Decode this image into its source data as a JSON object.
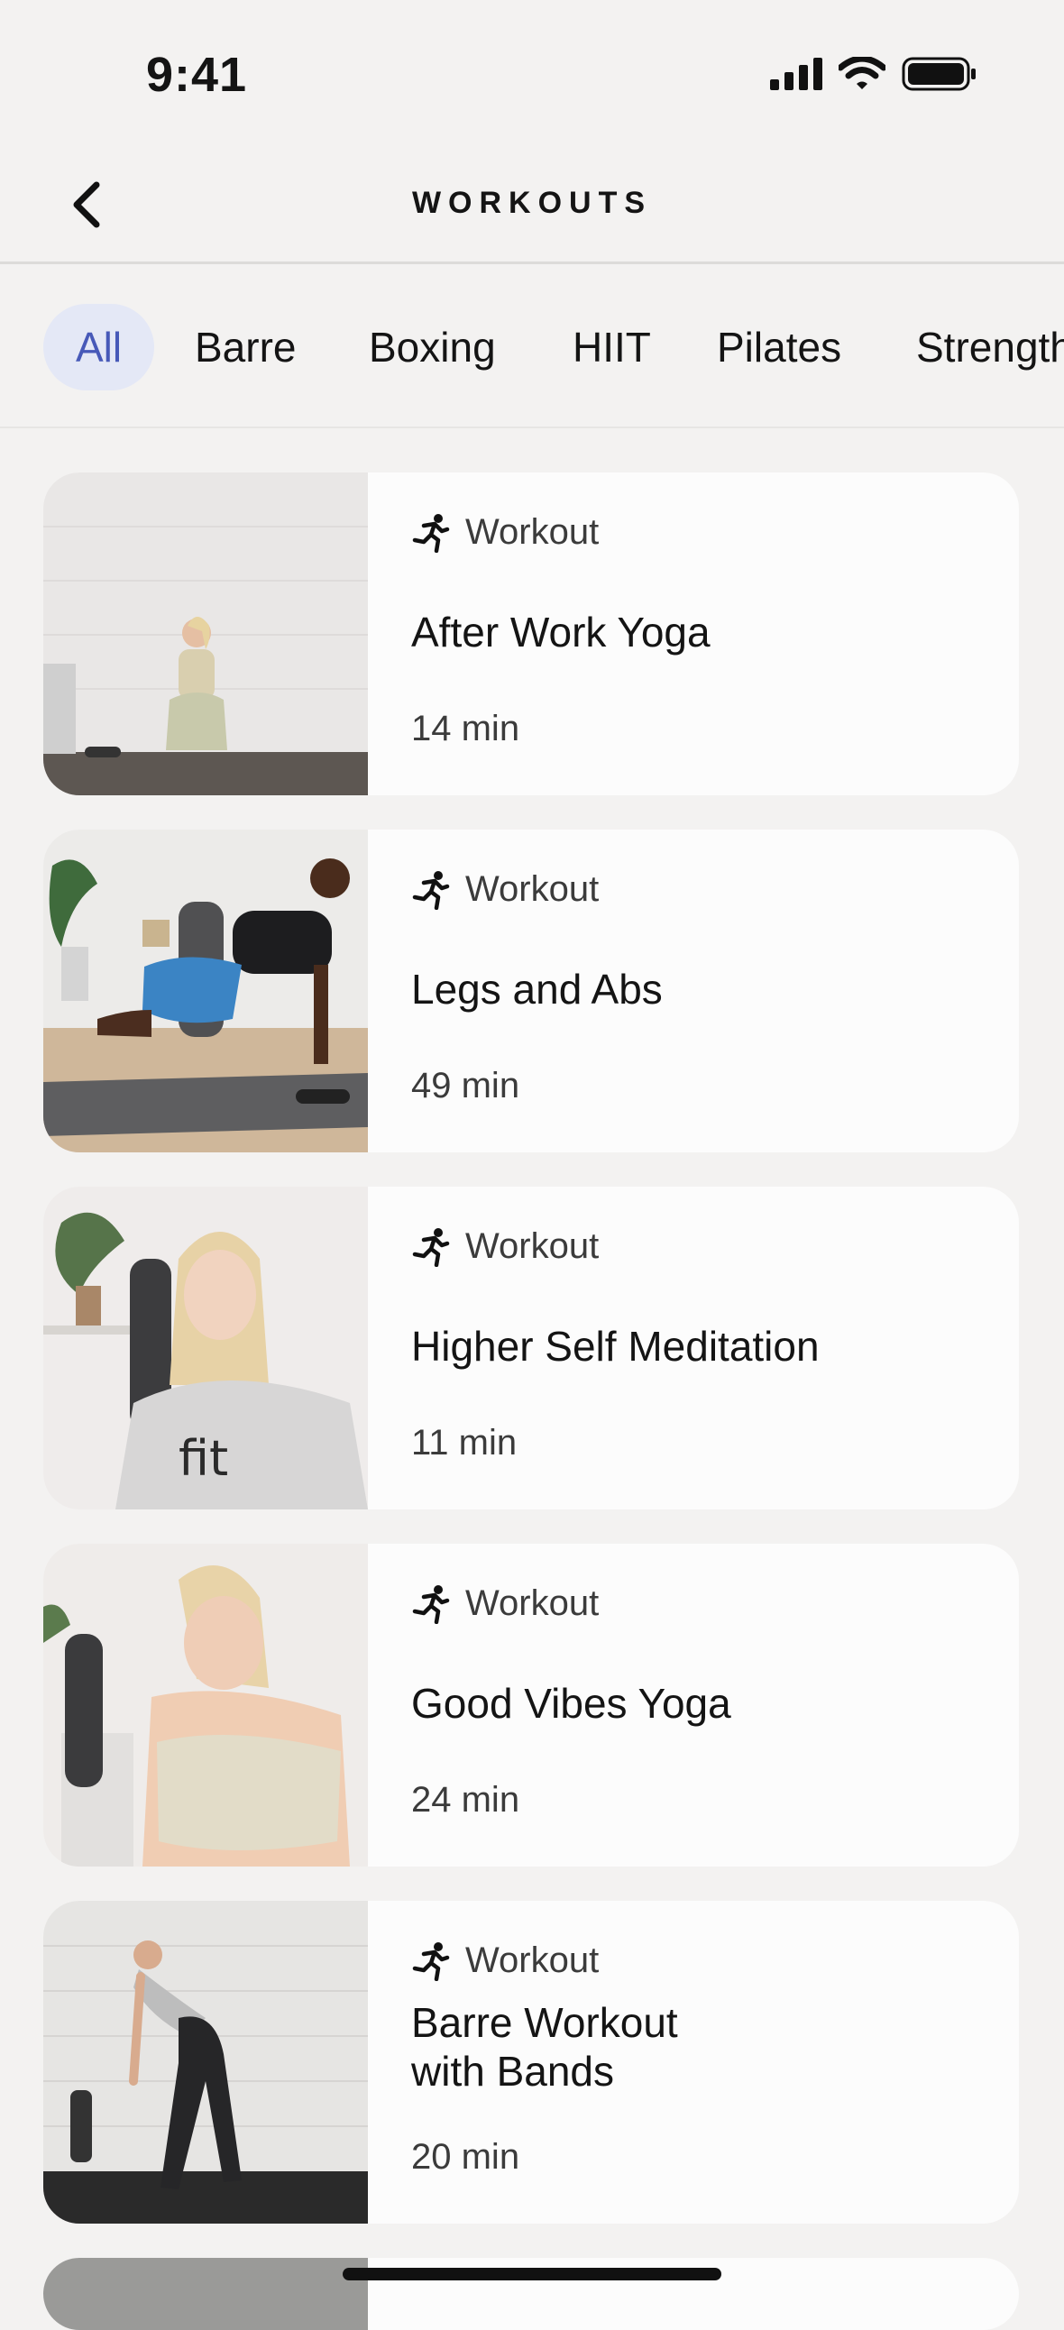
{
  "status": {
    "time": "9:41"
  },
  "nav": {
    "title": "WORKOUTS"
  },
  "filters": [
    "All",
    "Barre",
    "Boxing",
    "HIIT",
    "Pilates",
    "Strength"
  ],
  "active_filter": "All",
  "cards": [
    {
      "type": "Workout",
      "title": "After Work Yoga",
      "duration": "14 min"
    },
    {
      "type": "Workout",
      "title": "Legs and Abs",
      "duration": "49 min"
    },
    {
      "type": "Workout",
      "title": "Higher Self Meditation",
      "duration": "11 min"
    },
    {
      "type": "Workout",
      "title": "Good Vibes Yoga",
      "duration": "24 min"
    },
    {
      "type": "Workout",
      "title": "Barre Workout\nwith Bands",
      "duration": "20 min"
    }
  ],
  "colors": {
    "background": "#f3f2f1",
    "card": "#fcfcfc",
    "accent": "#4759b8",
    "chip_active_bg": "#e4e8f6"
  },
  "icons": {
    "type_icon": "running-person-icon",
    "back": "chevron-left-icon"
  }
}
